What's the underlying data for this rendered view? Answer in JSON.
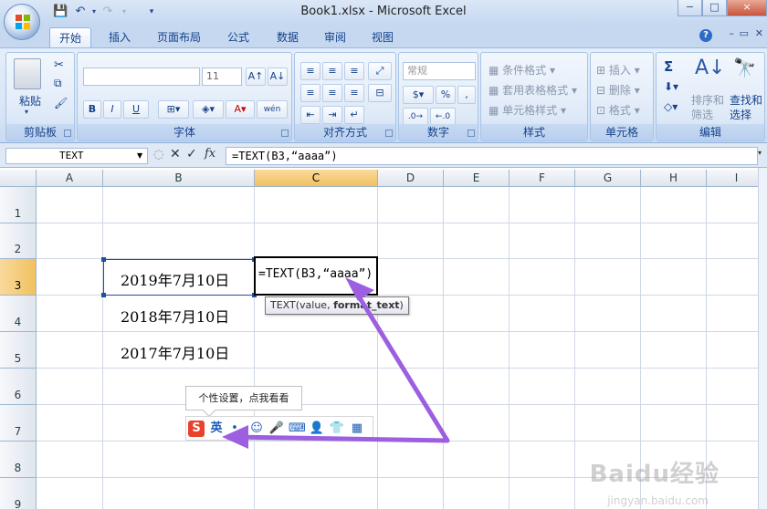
{
  "titlebar": {
    "title": "Book1.xlsx - Microsoft Excel",
    "qat": [
      "save-icon",
      "undo-icon",
      "redo-icon",
      "customize-icon"
    ],
    "window_controls": [
      "−",
      "□",
      "×"
    ]
  },
  "tabs": [
    "开始",
    "插入",
    "页面布局",
    "公式",
    "数据",
    "审阅",
    "视图"
  ],
  "active_tab": "开始",
  "ribbon": {
    "clipboard": {
      "label": "剪贴板",
      "paste": "粘贴"
    },
    "font": {
      "label": "字体",
      "font_name": "",
      "font_size": "11",
      "bold": "B",
      "italic": "I",
      "underline": "U",
      "wen": "wén"
    },
    "alignment": {
      "label": "对齐方式"
    },
    "number": {
      "label": "数字",
      "format": "常规",
      "percent": "%",
      "comma": ","
    },
    "styles": {
      "label": "样式",
      "cond_format": "条件格式",
      "table_format": "套用表格格式",
      "cell_style": "单元格样式"
    },
    "cells": {
      "label": "单元格",
      "insert": "插入",
      "delete": "删除",
      "format": "格式"
    },
    "editing": {
      "label": "编辑",
      "sigma": "Σ",
      "sort": "排序和\n筛选",
      "find": "查找和\n选择"
    }
  },
  "formula_bar": {
    "name_box": "TEXT",
    "formula": "=TEXT(B3,“aaaa”)"
  },
  "grid": {
    "columns": [
      "A",
      "B",
      "C",
      "D",
      "E",
      "F",
      "G",
      "H",
      "I"
    ],
    "selected_column": "C",
    "rows": [
      "1",
      "2",
      "3",
      "4",
      "5",
      "6",
      "7",
      "8",
      "9"
    ],
    "selected_row": "3",
    "cells": {
      "B3": "2019年7月10日",
      "B4": "2018年7月10日",
      "B5": "2017年7月10日",
      "C3": "=TEXT(B3,“aaaa”)"
    },
    "tooltip": {
      "prefix": "TEXT(value, ",
      "bold": "format_text",
      ")": ")"
    }
  },
  "ime": {
    "tip": "个性设置，点我看看",
    "lang": "英",
    "items": [
      "sogou-logo-icon",
      "lang-en",
      "punct-icon",
      "emoji-icon",
      "voice-icon",
      "keyboard-icon",
      "user-icon",
      "skin-icon",
      "toolbox-icon"
    ]
  },
  "watermark": {
    "brand": "Baidu经验",
    "url": "jingyan.baidu.com"
  },
  "colors": {
    "arrow": "#9c5fe0",
    "selection": "#1f4fa0",
    "header_sel": "#f1c15f"
  }
}
